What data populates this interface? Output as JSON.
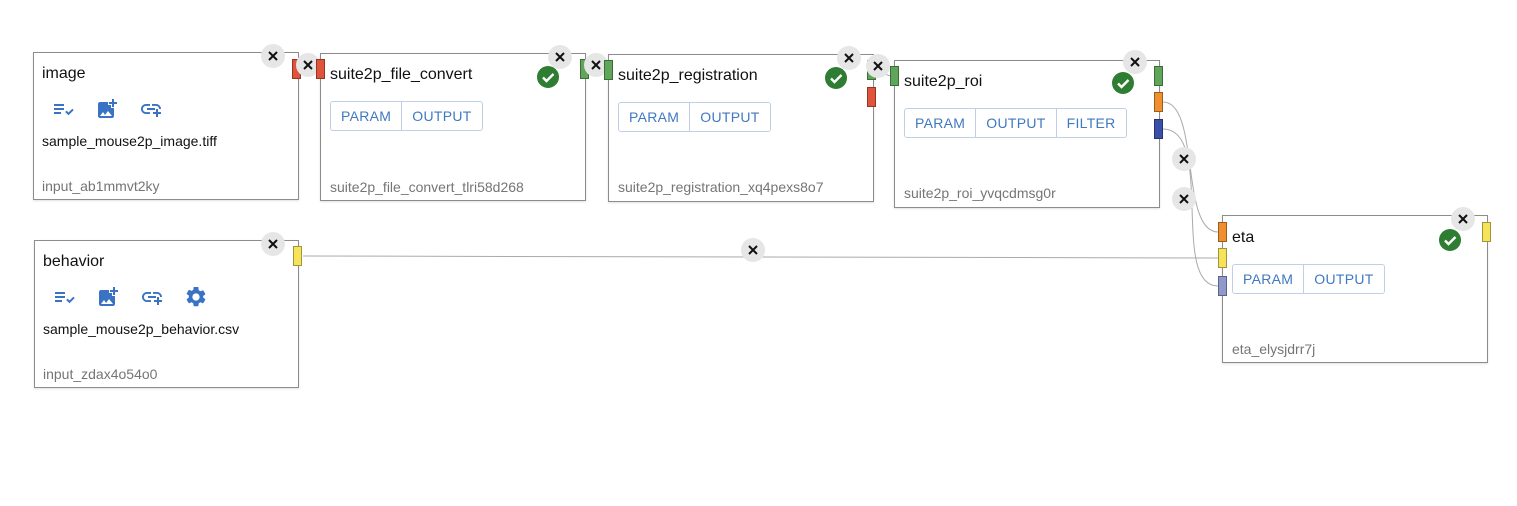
{
  "colors": {
    "check_green": "#2e7d32",
    "button_text": "#3f79c0",
    "handle_red": "#e0533a",
    "handle_green": "#5fa55a",
    "handle_orange": "#ef8f2f",
    "handle_blue": "#3a50a8",
    "handle_yellow": "#f7e35a",
    "handle_lavender": "#8f99cc"
  },
  "nodes": {
    "image": {
      "title": "image",
      "filename": "sample_mouse2p_image.tiff",
      "id": "input_ab1mmvt2ky",
      "icons": [
        "select-list-icon",
        "add-image-icon",
        "add-link-icon"
      ]
    },
    "behavior": {
      "title": "behavior",
      "filename": "sample_mouse2p_behavior.csv",
      "id": "input_zdax4o54o0",
      "icons": [
        "select-list-icon",
        "add-image-icon",
        "add-link-icon",
        "settings-gear-icon"
      ]
    },
    "file_convert": {
      "title": "suite2p_file_convert",
      "id": "suite2p_file_convert_tlri58d268",
      "buttons": [
        "PARAM",
        "OUTPUT"
      ]
    },
    "registration": {
      "title": "suite2p_registration",
      "id": "suite2p_registration_xq4pexs8o7",
      "buttons": [
        "PARAM",
        "OUTPUT"
      ]
    },
    "roi": {
      "title": "suite2p_roi",
      "id": "suite2p_roi_yvqcdmsg0r",
      "buttons": [
        "PARAM",
        "OUTPUT",
        "FILTER"
      ]
    },
    "eta": {
      "title": "eta",
      "id": "eta_elysjdrr7j",
      "buttons": [
        "PARAM",
        "OUTPUT"
      ]
    }
  }
}
